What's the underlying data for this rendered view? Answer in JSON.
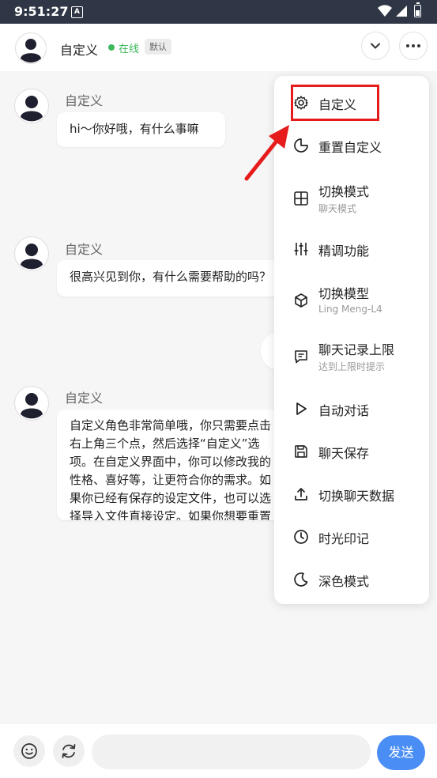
{
  "status_bar": {
    "time": "9:51:27",
    "app_badge": "A"
  },
  "header": {
    "name": "自定义",
    "status": "在线",
    "badge": "默认"
  },
  "messages": [
    {
      "sender": "自定义",
      "text": "hi～你好哦，有什么事嘛"
    },
    {
      "sender": "自定义",
      "text": "很高兴见到你，有什么需要帮助的吗？"
    },
    {
      "sender": "自定义",
      "text": "自定义角色非常简单哦，你只需要点击右上角三个点，然后选择“自定义”选项。在自定义界面中，你可以修改我的性格、喜好等，让更符合你的需求。如果你已经有保存的设定文件，也可以选择导入文件直接设定。如果你想要重置我的设定，只需点击“重置AI”即可。"
    }
  ],
  "menu": {
    "items": [
      {
        "label": "自定义",
        "icon": "gear-icon"
      },
      {
        "label": "重置自定义",
        "icon": "crescent-icon"
      },
      {
        "label": "切换模式",
        "sub": "聊天模式",
        "icon": "grid-icon"
      },
      {
        "label": "精调功能",
        "icon": "sliders-icon"
      },
      {
        "label": "切换模型",
        "sub": "Ling Meng-L4",
        "icon": "cube-icon"
      },
      {
        "label": "聊天记录上限",
        "sub": "达到上限时提示",
        "icon": "chat-bubble-icon"
      },
      {
        "label": "自动对话",
        "icon": "play-icon"
      },
      {
        "label": "聊天保存",
        "icon": "save-icon"
      },
      {
        "label": "切换聊天数据",
        "icon": "upload-icon"
      },
      {
        "label": "时光印记",
        "icon": "clock-icon"
      },
      {
        "label": "深色模式",
        "icon": "moon-icon"
      }
    ]
  },
  "input": {
    "value": "",
    "placeholder": ""
  },
  "send_label": "发送",
  "colors": {
    "accent": "#4a8ef5",
    "online": "#3db85c",
    "highlight": "#e61c1c",
    "status_bar": "#2f3645"
  }
}
